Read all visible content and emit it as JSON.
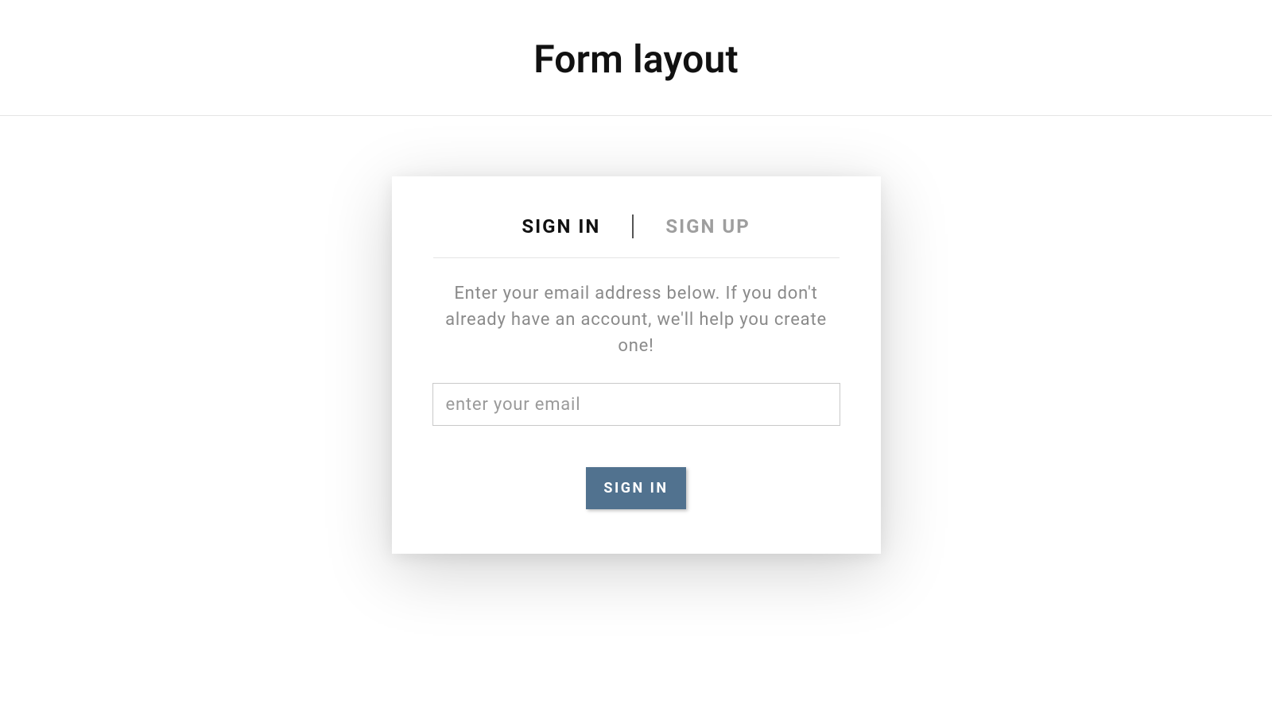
{
  "header": {
    "title": "Form layout"
  },
  "card": {
    "tabs": {
      "sign_in": "SIGN IN",
      "sign_up": "SIGN UP"
    },
    "description": "Enter your email address below. If you don't already have an account, we'll help you create one!",
    "email": {
      "placeholder": "enter your email",
      "value": ""
    },
    "submit_label": "SIGN IN"
  },
  "colors": {
    "accent": "#51728f"
  }
}
